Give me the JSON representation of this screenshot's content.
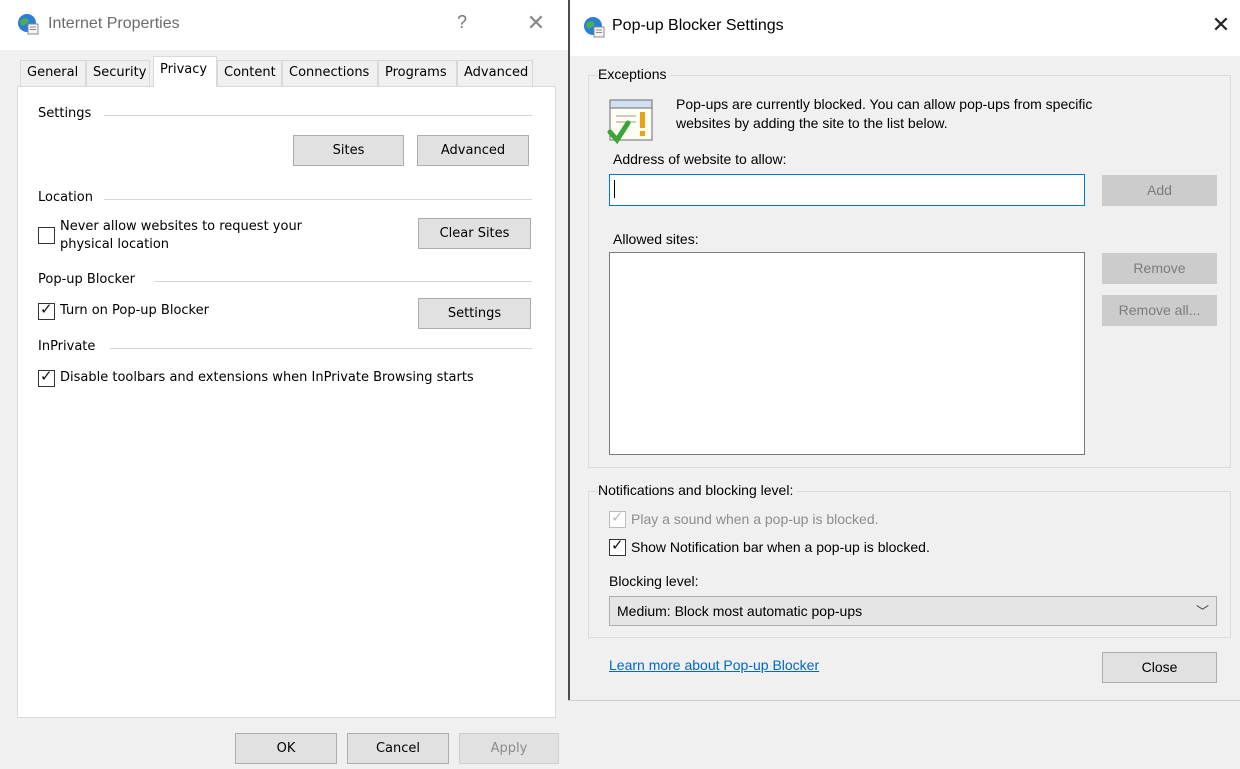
{
  "internet_properties": {
    "title": "Internet Properties",
    "help_glyph": "?",
    "close_glyph": "✕",
    "tabs": [
      "General",
      "Security",
      "Privacy",
      "Content",
      "Connections",
      "Programs",
      "Advanced"
    ],
    "active_tab": "Privacy",
    "settings": {
      "header": "Settings",
      "sites_label": "Sites",
      "advanced_label": "Advanced"
    },
    "location": {
      "header": "Location",
      "never_allow_line1": "Never allow websites to request your",
      "never_allow_line2": "physical location",
      "never_allow_checked": false,
      "clear_sites_label": "Clear Sites"
    },
    "popup_blocker": {
      "header": "Pop-up Blocker",
      "turn_on_label": "Turn on Pop-up Blocker",
      "turn_on_checked": true,
      "settings_label": "Settings"
    },
    "inprivate": {
      "header": "InPrivate",
      "disable_label": "Disable toolbars and extensions when InPrivate Browsing starts",
      "disable_checked": true
    },
    "footer": {
      "ok_label": "OK",
      "cancel_label": "Cancel",
      "apply_label": "Apply"
    }
  },
  "popup_settings": {
    "title": "Pop-up Blocker Settings",
    "close_glyph": "✕",
    "exceptions": {
      "legend": "Exceptions",
      "info_line1": "Pop-ups are currently blocked.  You can allow pop-ups from specific",
      "info_line2": "websites by adding the site to the list below.",
      "address_label": "Address of website to allow:",
      "address_value": "",
      "add_label": "Add",
      "allowed_label": "Allowed sites:",
      "allowed_sites": [],
      "remove_label": "Remove",
      "remove_all_label": "Remove all..."
    },
    "notifications": {
      "legend": "Notifications and blocking level:",
      "play_sound_label": "Play a sound when a pop-up is blocked.",
      "play_sound_checked": true,
      "play_sound_enabled": false,
      "show_bar_label": "Show Notification bar when a pop-up is blocked.",
      "show_bar_checked": true,
      "blocking_level_label": "Blocking level:",
      "blocking_level_value": "Medium: Block most automatic pop-ups"
    },
    "learn_more_link": "Learn more about Pop-up Blocker",
    "close_label": "Close"
  },
  "icons": {
    "globe": "globe-document-icon",
    "warning": "popup-warning-icon",
    "check": "✓",
    "chevron": "﹀"
  },
  "colors": {
    "accent_focus": "#0078d7",
    "link": "#0066cc",
    "disabled_button": "#cccccc"
  }
}
